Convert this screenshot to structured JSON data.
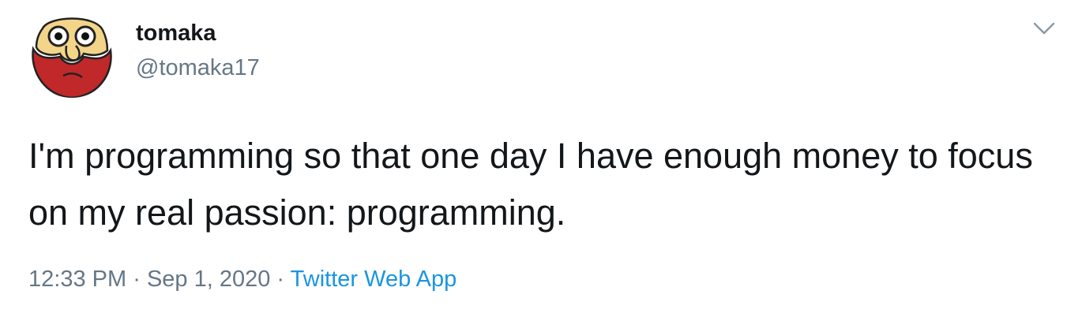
{
  "user": {
    "display_name": "tomaka",
    "handle": "@tomaka17"
  },
  "tweet": {
    "text": "I'm programming so that one day I have enough money to focus on my real passion: programming."
  },
  "meta": {
    "time": "12:33 PM",
    "separator": "·",
    "date": "Sep 1, 2020",
    "source": "Twitter Web App"
  },
  "icons": {
    "avatar": "cartoon-face-avatar",
    "caret": "chevron-down-icon"
  },
  "colors": {
    "text": "#14171a",
    "secondary": "#657786",
    "link": "#1b95e0",
    "avatar_beard": "#c0282a"
  }
}
